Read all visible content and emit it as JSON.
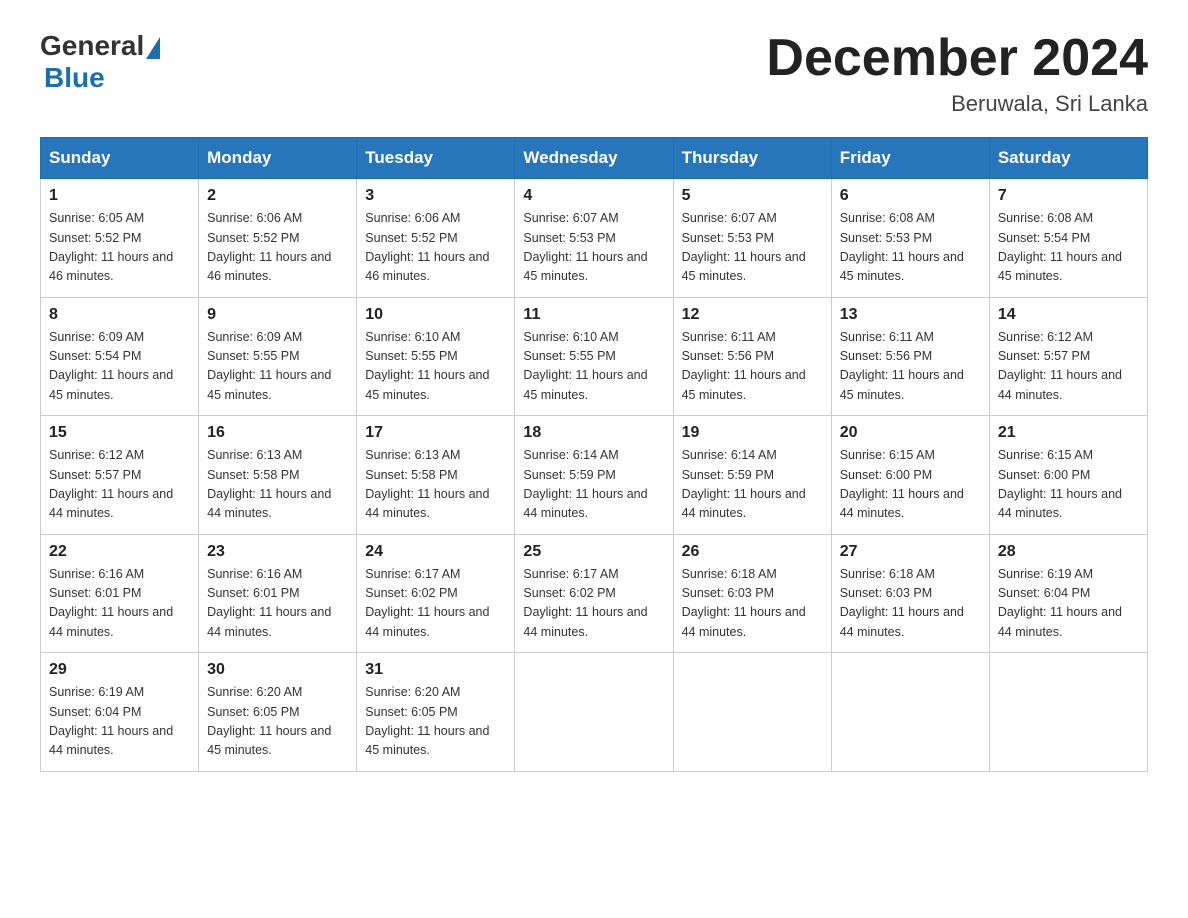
{
  "header": {
    "logo_general": "General",
    "logo_blue": "Blue",
    "title": "December 2024",
    "location": "Beruwala, Sri Lanka"
  },
  "days_of_week": [
    "Sunday",
    "Monday",
    "Tuesday",
    "Wednesday",
    "Thursday",
    "Friday",
    "Saturday"
  ],
  "weeks": [
    [
      {
        "day": "1",
        "sunrise": "6:05 AM",
        "sunset": "5:52 PM",
        "daylight": "11 hours and 46 minutes."
      },
      {
        "day": "2",
        "sunrise": "6:06 AM",
        "sunset": "5:52 PM",
        "daylight": "11 hours and 46 minutes."
      },
      {
        "day": "3",
        "sunrise": "6:06 AM",
        "sunset": "5:52 PM",
        "daylight": "11 hours and 46 minutes."
      },
      {
        "day": "4",
        "sunrise": "6:07 AM",
        "sunset": "5:53 PM",
        "daylight": "11 hours and 45 minutes."
      },
      {
        "day": "5",
        "sunrise": "6:07 AM",
        "sunset": "5:53 PM",
        "daylight": "11 hours and 45 minutes."
      },
      {
        "day": "6",
        "sunrise": "6:08 AM",
        "sunset": "5:53 PM",
        "daylight": "11 hours and 45 minutes."
      },
      {
        "day": "7",
        "sunrise": "6:08 AM",
        "sunset": "5:54 PM",
        "daylight": "11 hours and 45 minutes."
      }
    ],
    [
      {
        "day": "8",
        "sunrise": "6:09 AM",
        "sunset": "5:54 PM",
        "daylight": "11 hours and 45 minutes."
      },
      {
        "day": "9",
        "sunrise": "6:09 AM",
        "sunset": "5:55 PM",
        "daylight": "11 hours and 45 minutes."
      },
      {
        "day": "10",
        "sunrise": "6:10 AM",
        "sunset": "5:55 PM",
        "daylight": "11 hours and 45 minutes."
      },
      {
        "day": "11",
        "sunrise": "6:10 AM",
        "sunset": "5:55 PM",
        "daylight": "11 hours and 45 minutes."
      },
      {
        "day": "12",
        "sunrise": "6:11 AM",
        "sunset": "5:56 PM",
        "daylight": "11 hours and 45 minutes."
      },
      {
        "day": "13",
        "sunrise": "6:11 AM",
        "sunset": "5:56 PM",
        "daylight": "11 hours and 45 minutes."
      },
      {
        "day": "14",
        "sunrise": "6:12 AM",
        "sunset": "5:57 PM",
        "daylight": "11 hours and 44 minutes."
      }
    ],
    [
      {
        "day": "15",
        "sunrise": "6:12 AM",
        "sunset": "5:57 PM",
        "daylight": "11 hours and 44 minutes."
      },
      {
        "day": "16",
        "sunrise": "6:13 AM",
        "sunset": "5:58 PM",
        "daylight": "11 hours and 44 minutes."
      },
      {
        "day": "17",
        "sunrise": "6:13 AM",
        "sunset": "5:58 PM",
        "daylight": "11 hours and 44 minutes."
      },
      {
        "day": "18",
        "sunrise": "6:14 AM",
        "sunset": "5:59 PM",
        "daylight": "11 hours and 44 minutes."
      },
      {
        "day": "19",
        "sunrise": "6:14 AM",
        "sunset": "5:59 PM",
        "daylight": "11 hours and 44 minutes."
      },
      {
        "day": "20",
        "sunrise": "6:15 AM",
        "sunset": "6:00 PM",
        "daylight": "11 hours and 44 minutes."
      },
      {
        "day": "21",
        "sunrise": "6:15 AM",
        "sunset": "6:00 PM",
        "daylight": "11 hours and 44 minutes."
      }
    ],
    [
      {
        "day": "22",
        "sunrise": "6:16 AM",
        "sunset": "6:01 PM",
        "daylight": "11 hours and 44 minutes."
      },
      {
        "day": "23",
        "sunrise": "6:16 AM",
        "sunset": "6:01 PM",
        "daylight": "11 hours and 44 minutes."
      },
      {
        "day": "24",
        "sunrise": "6:17 AM",
        "sunset": "6:02 PM",
        "daylight": "11 hours and 44 minutes."
      },
      {
        "day": "25",
        "sunrise": "6:17 AM",
        "sunset": "6:02 PM",
        "daylight": "11 hours and 44 minutes."
      },
      {
        "day": "26",
        "sunrise": "6:18 AM",
        "sunset": "6:03 PM",
        "daylight": "11 hours and 44 minutes."
      },
      {
        "day": "27",
        "sunrise": "6:18 AM",
        "sunset": "6:03 PM",
        "daylight": "11 hours and 44 minutes."
      },
      {
        "day": "28",
        "sunrise": "6:19 AM",
        "sunset": "6:04 PM",
        "daylight": "11 hours and 44 minutes."
      }
    ],
    [
      {
        "day": "29",
        "sunrise": "6:19 AM",
        "sunset": "6:04 PM",
        "daylight": "11 hours and 44 minutes."
      },
      {
        "day": "30",
        "sunrise": "6:20 AM",
        "sunset": "6:05 PM",
        "daylight": "11 hours and 45 minutes."
      },
      {
        "day": "31",
        "sunrise": "6:20 AM",
        "sunset": "6:05 PM",
        "daylight": "11 hours and 45 minutes."
      },
      null,
      null,
      null,
      null
    ]
  ]
}
